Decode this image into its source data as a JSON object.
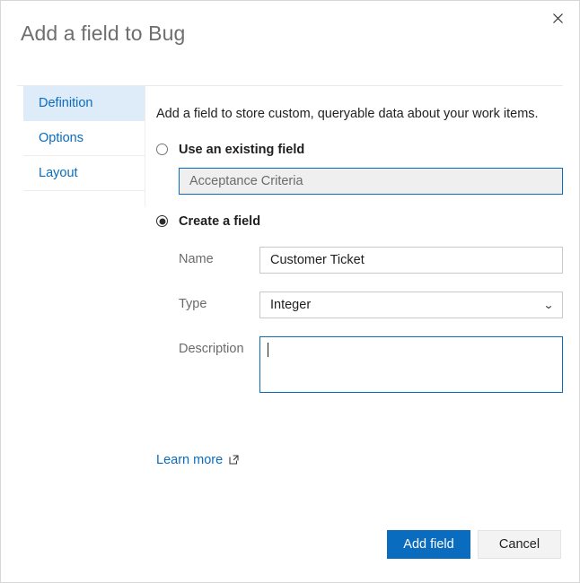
{
  "dialog": {
    "title": "Add a field to Bug",
    "close_icon": "close-icon"
  },
  "tabs": [
    {
      "label": "Definition",
      "selected": true
    },
    {
      "label": "Options",
      "selected": false
    },
    {
      "label": "Layout",
      "selected": false
    }
  ],
  "main": {
    "intro": "Add a field to store custom, queryable data about your work items.",
    "existing_field": {
      "radio_label": "Use an existing field",
      "selected": false,
      "value": "Acceptance Criteria"
    },
    "create_field": {
      "radio_label": "Create a field",
      "selected": true,
      "name_label": "Name",
      "name_value": "Customer Ticket",
      "type_label": "Type",
      "type_value": "Integer",
      "type_chevron_icon": "chevron-down-icon",
      "description_label": "Description",
      "description_value": ""
    },
    "learn_more": {
      "label": "Learn more",
      "icon": "external-link-icon"
    }
  },
  "footer": {
    "primary_label": "Add field",
    "secondary_label": "Cancel"
  },
  "colors": {
    "accent_blue": "#0a6cbf",
    "selected_tab_bg": "#deecf9",
    "disabled_field_bg": "#efefef",
    "title_gray": "#6e6e6e"
  }
}
